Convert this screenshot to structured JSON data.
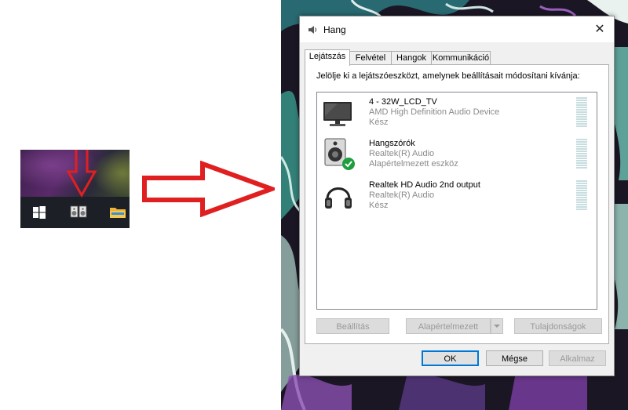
{
  "taskbar": {
    "icons": [
      "windows-start-icon",
      "speaker-icon",
      "folder-icon"
    ],
    "arrow_color": "#e02020"
  },
  "dialog": {
    "title": "Hang",
    "close": "✕",
    "tabs": [
      {
        "label": "Lejátszás",
        "active": true
      },
      {
        "label": "Felvétel",
        "active": false
      },
      {
        "label": "Hangok",
        "active": false
      },
      {
        "label": "Kommunikáció",
        "active": false
      }
    ],
    "instruction": "Jelölje ki a lejátszóeszközt, amelynek beállításait módosítani kívánja:",
    "devices": [
      {
        "name": "4 - 32W_LCD_TV",
        "driver": "AMD High Definition Audio Device",
        "status": "Kész",
        "icon": "monitor-icon"
      },
      {
        "name": "Hangszórók",
        "driver": "Realtek(R) Audio",
        "status": "Alapértelmezett eszköz",
        "icon": "speaker-default-icon"
      },
      {
        "name": "Realtek HD Audio 2nd output",
        "driver": "Realtek(R) Audio",
        "status": "Kész",
        "icon": "headphones-icon"
      }
    ],
    "buttons": {
      "configure": "Beállítás",
      "set_default": "Alapértelmezett",
      "properties": "Tulajdonságok",
      "ok": "OK",
      "cancel": "Mégse",
      "apply": "Alkalmaz"
    }
  }
}
